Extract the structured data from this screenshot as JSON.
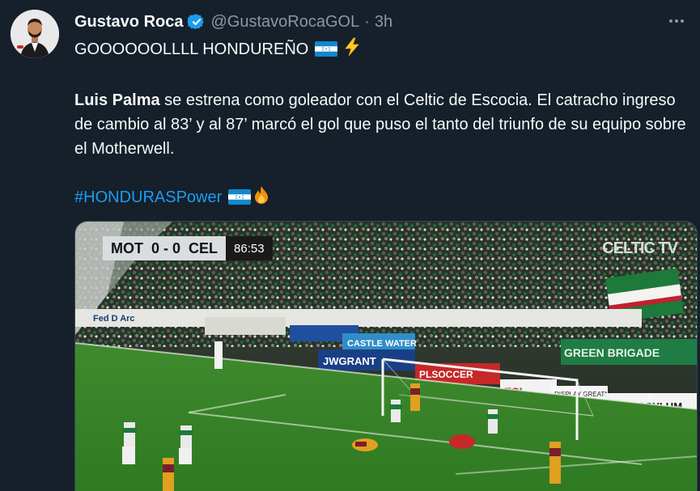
{
  "author": {
    "name": "Gustavo Roca",
    "handle": "@GustavoRocaGOL",
    "separator": "·",
    "time": "3h"
  },
  "icons": {
    "verified": "verified-badge-icon",
    "more": "more-options-icon",
    "flag": "honduras-flag-icon",
    "lightning": "high-voltage-icon",
    "fire": "fire-icon"
  },
  "colors": {
    "background": "#15202b",
    "text": "#f7f9f9",
    "muted": "#8b98a5",
    "link": "#1d9bf0",
    "verified": "#1d9bf0"
  },
  "tweet": {
    "line1": "GOOOOOOLLLL HONDUREÑO",
    "player": "Luis Palma",
    "paragraph": " se estrena como goleador con el Celtic de Escocia. El catracho ingreso de cambio al 83’ y al 87’ marcó el gol que puso el tanto del triunfo de su equipo sobre el Motherwell.",
    "hashtag": "#HONDURASPower"
  },
  "media": {
    "scoreboard": {
      "home": "MOT",
      "score": "0 - 0",
      "away": "CEL",
      "clock": "86:53"
    },
    "channel": "CELTIC TV",
    "ad_boards": [
      "Fed D Arc",
      "CASTLE WATER",
      "JWGRANT",
      "PLSOCCER",
      "TCL",
      "DISPLAY GREATNESS",
      "FOOTASYLUM",
      "GREEN BRIGADE"
    ]
  }
}
